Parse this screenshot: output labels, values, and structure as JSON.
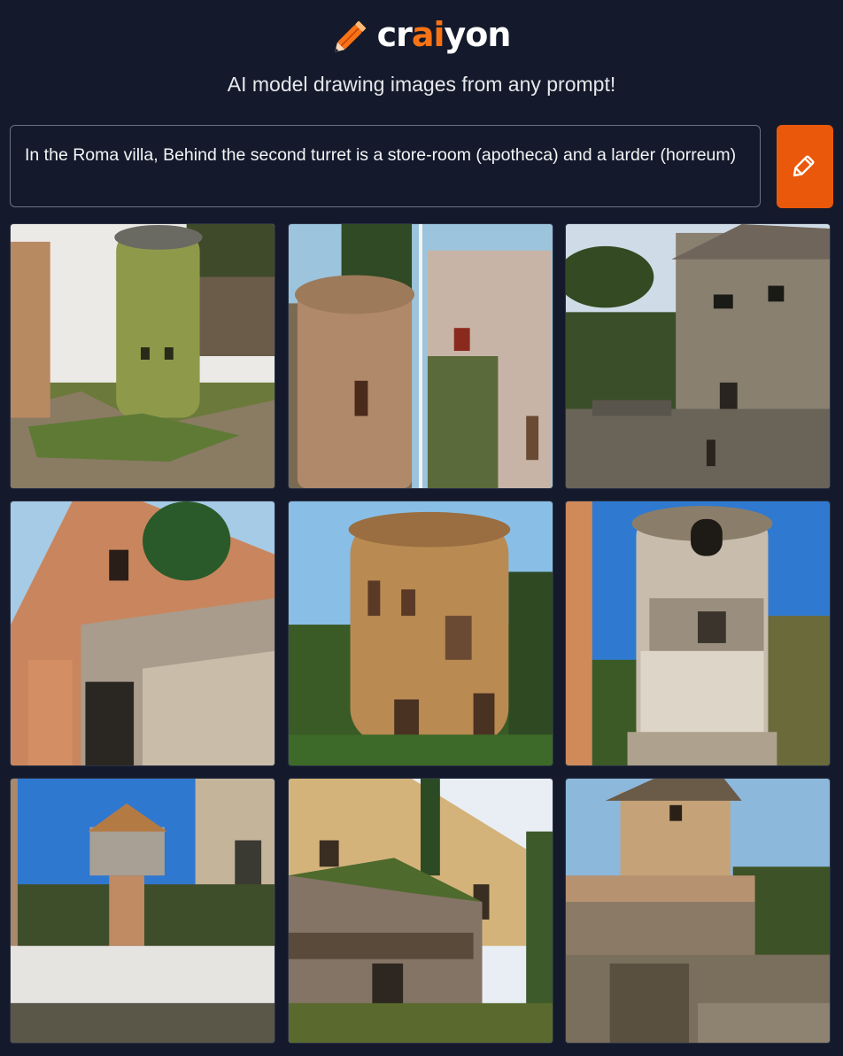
{
  "header": {
    "logo_text_before": "cr",
    "logo_text_accent": "ai",
    "logo_text_after": "yon",
    "logo_icon": "pencil-icon",
    "tagline": "AI model drawing images from any prompt!"
  },
  "prompt": {
    "value": "In the Roma villa, Behind the second turret is a store-room (apotheca) and a larder (horreum)",
    "button_icon": "pencil-icon"
  },
  "colors": {
    "background": "#141a2b",
    "accent": "#ea580c",
    "logo_accent": "#f97316"
  },
  "results": {
    "count": 9
  }
}
